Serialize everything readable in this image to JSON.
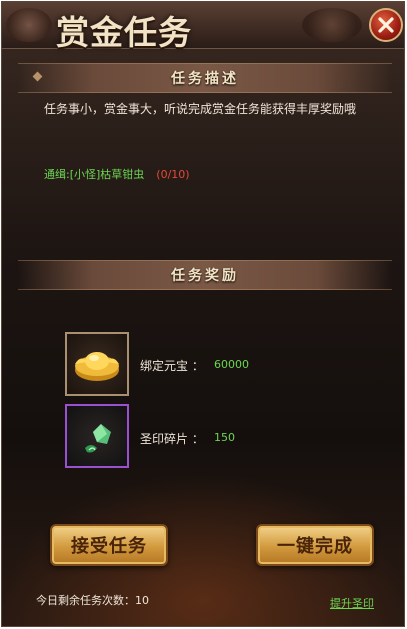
{
  "window": {
    "title": "赏金任务"
  },
  "sections": {
    "description_title": "任务描述",
    "reward_title": "任务奖励"
  },
  "description": {
    "text": "任务事小，赏金事大，听说完成赏金任务能获得丰厚奖励哦",
    "bounty_label": "通缉:[小怪]枯草钳虫",
    "bounty_progress": "(0/10)"
  },
  "rewards": [
    {
      "name": "绑定元宝 ：",
      "value": "60000",
      "icon": "gold-ingot-icon"
    },
    {
      "name": "圣印碎片 ：",
      "value": "150",
      "icon": "seal-fragment-icon"
    }
  ],
  "buttons": {
    "accept": "接受任务",
    "complete": "一键完成"
  },
  "footer": {
    "remaining": "今日剩余任务次数：10",
    "upgrade_link": "提升圣印"
  },
  "colors": {
    "accent_green": "#6cd653",
    "progress_red": "#e34a3a",
    "button_gold": "#d29a3e",
    "rare_purple": "#9b4fd1"
  }
}
